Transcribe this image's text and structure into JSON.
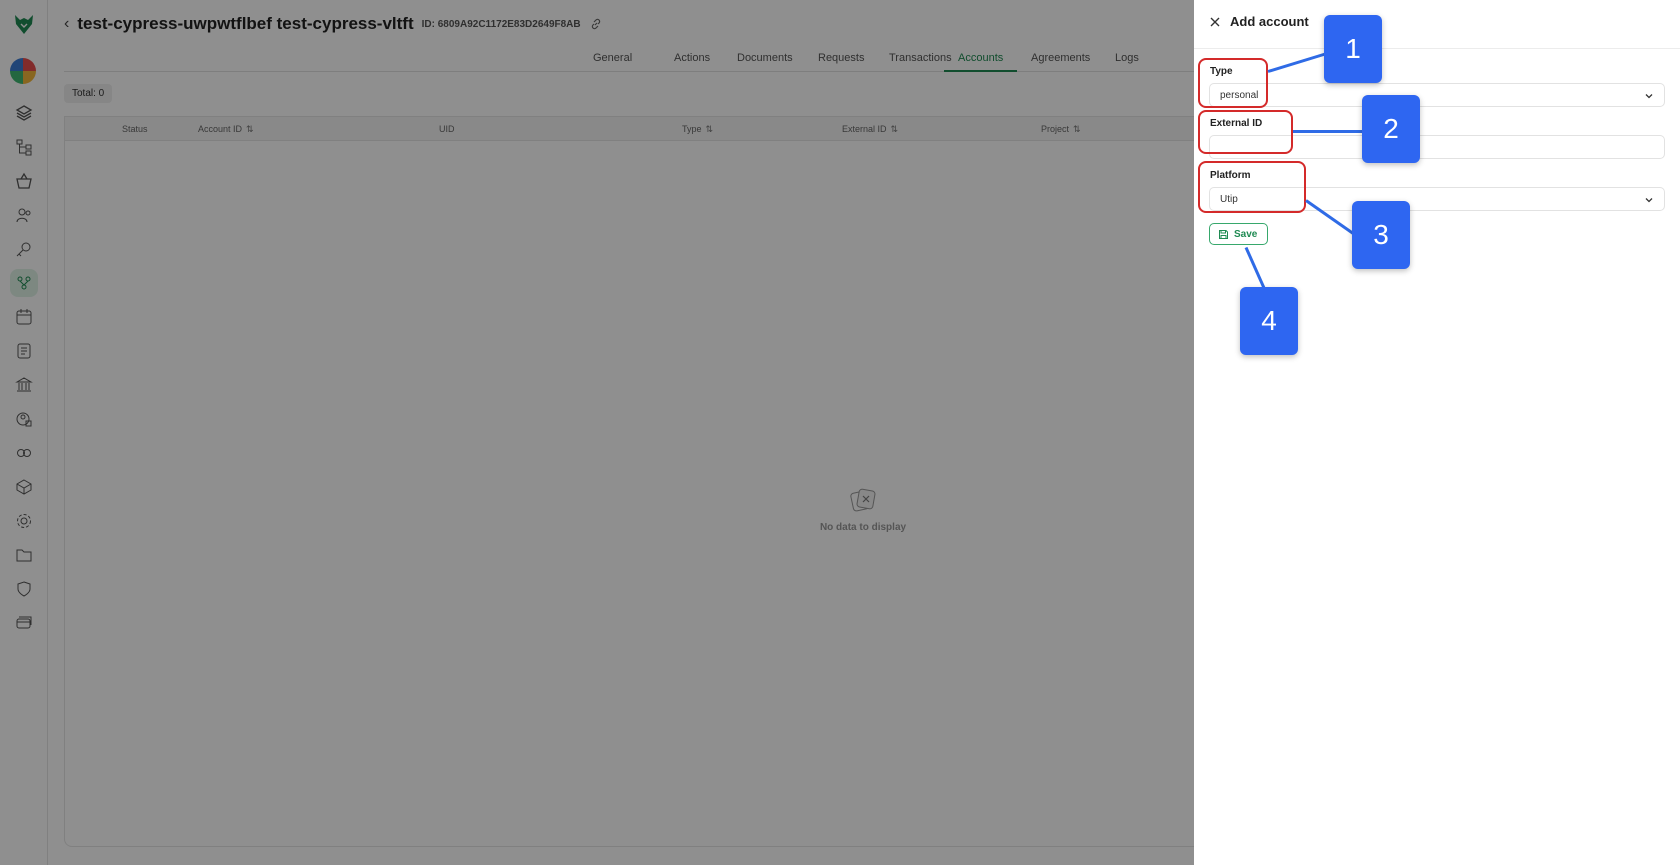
{
  "header": {
    "back_glyph": "‹",
    "title": "test-cypress-uwpwtflbef test-cypress-vltft",
    "id_text": "ID: 6809A92C1172E83D2649F8AB"
  },
  "tabs": [
    "General",
    "Actions",
    "Documents",
    "Requests",
    "Transactions",
    "Accounts",
    "Agreements",
    "Logs"
  ],
  "active_tab": "Accounts",
  "table": {
    "total": "Total: 0",
    "columns": [
      "Status",
      "Account ID",
      "UID",
      "Type",
      "External ID",
      "Project"
    ],
    "sort_glyph": "⇅",
    "empty_text": "No data to display"
  },
  "drawer": {
    "title": "Add account",
    "type_label": "Type",
    "type_value": "personal",
    "external_id_label": "External ID",
    "external_id_value": "",
    "platform_label": "Platform",
    "platform_value": "Utip",
    "save_label": "Save"
  },
  "annotations": [
    "1",
    "2",
    "3",
    "4"
  ],
  "colors": {
    "accent": "#1f8a52",
    "highlight": "#d42a2a",
    "callout": "#2e66f1"
  }
}
